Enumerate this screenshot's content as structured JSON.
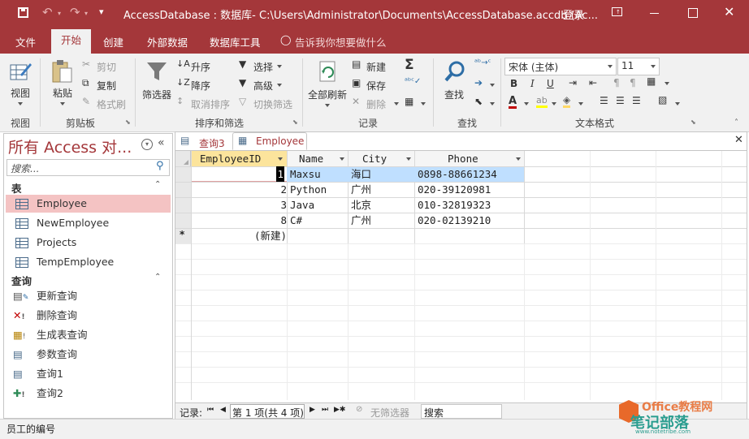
{
  "titlebar": {
    "title": "AccessDatabase : 数据库- C:\\Users\\Administrator\\Documents\\AccessDatabase.accdb (Ac...",
    "login": "登录",
    "qat_customize": "▾"
  },
  "menu": {
    "tabs": [
      "文件",
      "开始",
      "创建",
      "外部数据",
      "数据库工具"
    ],
    "tell_me": "告诉我你想要做什么"
  },
  "ribbon": {
    "view": {
      "label": "视图",
      "group": "视图"
    },
    "clipboard": {
      "paste": "粘贴",
      "cut": "剪切",
      "copy": "复制",
      "format_painter": "格式刷",
      "group": "剪贴板"
    },
    "sort_filter": {
      "filter": "筛选器",
      "asc": "升序",
      "desc": "降序",
      "remove_sort": "取消排序",
      "selection": "选择",
      "advanced": "高级",
      "toggle_filter": "切换筛选",
      "group": "排序和筛选"
    },
    "records": {
      "refresh_all": "全部刷新",
      "new": "新建",
      "save": "保存",
      "delete": "删除",
      "group": "记录"
    },
    "find": {
      "find": "查找",
      "group": "查找"
    },
    "text_format": {
      "font": "宋体 (主体)",
      "size": "11",
      "bold": "B",
      "italic": "I",
      "underline": "U",
      "group": "文本格式"
    }
  },
  "nav": {
    "title": "所有 Access 对...",
    "search_placeholder": "搜索...",
    "sections": [
      {
        "name": "表",
        "items": [
          "Employee",
          "NewEmployee",
          "Projects",
          "TempEmployee"
        ]
      },
      {
        "name": "查询",
        "items": [
          "更新查询",
          "删除查询",
          "生成表查询",
          "参数查询",
          "查询1",
          "查询2"
        ]
      }
    ]
  },
  "doc_tabs": [
    "查询3",
    "Employee"
  ],
  "grid": {
    "columns": [
      "EmployeeID",
      "Name",
      "City",
      "Phone"
    ],
    "rows": [
      [
        "1",
        "Maxsu",
        "海口",
        "0898-88661234"
      ],
      [
        "2",
        "Python",
        "广州",
        "020-39120981"
      ],
      [
        "3",
        "Java",
        "北京",
        "010-32819323"
      ],
      [
        "8",
        "C#",
        "广州",
        "020-02139210"
      ]
    ],
    "new_row": "(新建)",
    "new_row_marker": "*"
  },
  "record_nav": {
    "label": "记录:",
    "position": "第 1 项(共 4 项)",
    "no_filter": "无筛选器",
    "search": "搜索"
  },
  "status": {
    "text": "员工的编号"
  },
  "watermark": {
    "line1": "Office教程网",
    "line2": "笔记部落",
    "url": "www.notetribe.com"
  },
  "colors": {
    "accent": "#a4373a",
    "selected_row": "#bfdfff",
    "nav_selected": "#f4c3c3",
    "header_selected": "#fce49c"
  }
}
